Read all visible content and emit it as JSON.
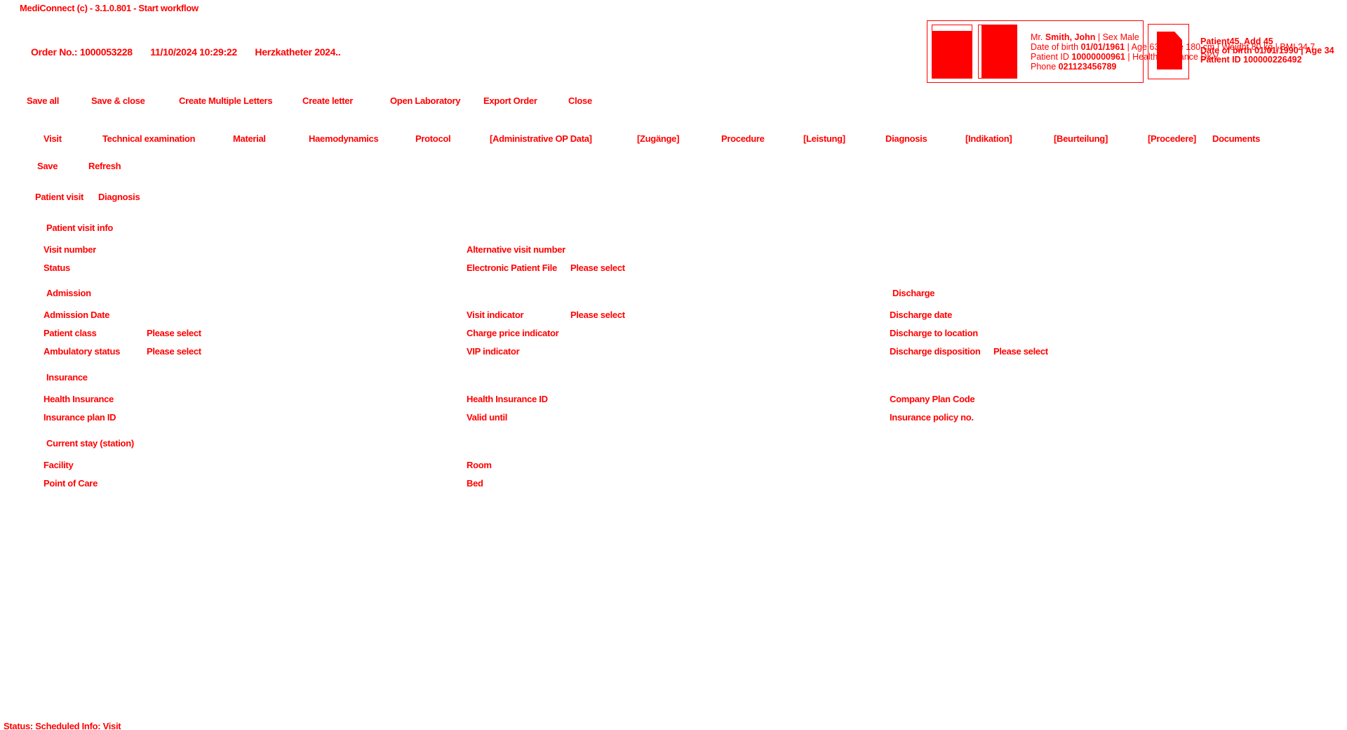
{
  "window": {
    "title": "MediConnect (c) - 3.1.0.801 - Start workflow"
  },
  "order": {
    "number_label": "Order No.: 1000053228",
    "datetime": "11/10/2024 10:29:22",
    "description": "Herzkatheter 2024.."
  },
  "patient_card": {
    "line1_prefix": "Mr.",
    "line1_name": "Smith, John",
    "line1_sex": "| Sex Male",
    "line2_label": "Date of birth",
    "line2_value": "01/01/1961",
    "line2_tail": "| Age 63 | Size 180 cm | Weight 80 kg | BMI 24.7",
    "line3_label": "Patient ID",
    "line3_value": "10000000961",
    "line3_tail": "| Health insurance DKV",
    "line4_label": "Phone",
    "line4_value": "021123456789"
  },
  "second_patient": {
    "name": "Patient45, Add 45",
    "dob": "Date of birth 01/01/1990 | Age 34",
    "id": "Patient ID 100000226492"
  },
  "toolbar": {
    "save_all": "Save all",
    "save_close": "Save & close",
    "create_multiple": "Create Multiple Letters",
    "create_letter": "Create letter",
    "open_lab": "Open Laboratory",
    "export_order": "Export Order",
    "close": "Close"
  },
  "tabs": [
    "Visit",
    "Technical examination",
    "Material",
    "Haemodynamics",
    "Protocol",
    "[Administrative OP Data]",
    "[Zugänge]",
    "Procedure",
    "[Leistung]",
    "Diagnosis",
    "[Indikation]",
    "[Beurteilung]",
    "[Procedere]",
    "Documents"
  ],
  "sub_toolbar": {
    "save": "Save",
    "refresh": "Refresh"
  },
  "subtabs": [
    "Patient visit",
    "Diagnosis"
  ],
  "sections": {
    "patient_visit_info": "Patient visit info",
    "admission": "Admission",
    "discharge": "Discharge",
    "insurance": "Insurance",
    "current_stay": "Current stay (station)"
  },
  "fields": {
    "visit_number": "Visit number",
    "alt_visit_number": "Alternative visit number",
    "status": "Status",
    "electronic_patient_file": "Electronic Patient File",
    "electronic_patient_file_value": "Please select",
    "admission_date": "Admission Date",
    "visit_indicator": "Visit indicator",
    "visit_indicator_value": "Please select",
    "discharge_date": "Discharge date",
    "patient_class": "Patient class",
    "patient_class_value": "Please select",
    "charge_price_indicator": "Charge price indicator",
    "discharge_to_location": "Discharge to location",
    "ambulatory_status": "Ambulatory status",
    "ambulatory_status_value": "Please select",
    "vip_indicator": "VIP indicator",
    "discharge_disposition": "Discharge disposition",
    "discharge_disposition_value": "Please select",
    "health_insurance": "Health Insurance",
    "health_insurance_id": "Health Insurance ID",
    "company_plan_code": "Company Plan Code",
    "insurance_plan_id": "Insurance plan ID",
    "valid_until": "Valid until",
    "insurance_policy_no": "Insurance policy no.",
    "facility": "Facility",
    "room": "Room",
    "point_of_care": "Point of Care",
    "bed": "Bed"
  },
  "status_bar": {
    "text": "Status: Scheduled   Info: Visit"
  },
  "colors": {
    "foreground": "#ff0000",
    "background": "#ffffff"
  }
}
